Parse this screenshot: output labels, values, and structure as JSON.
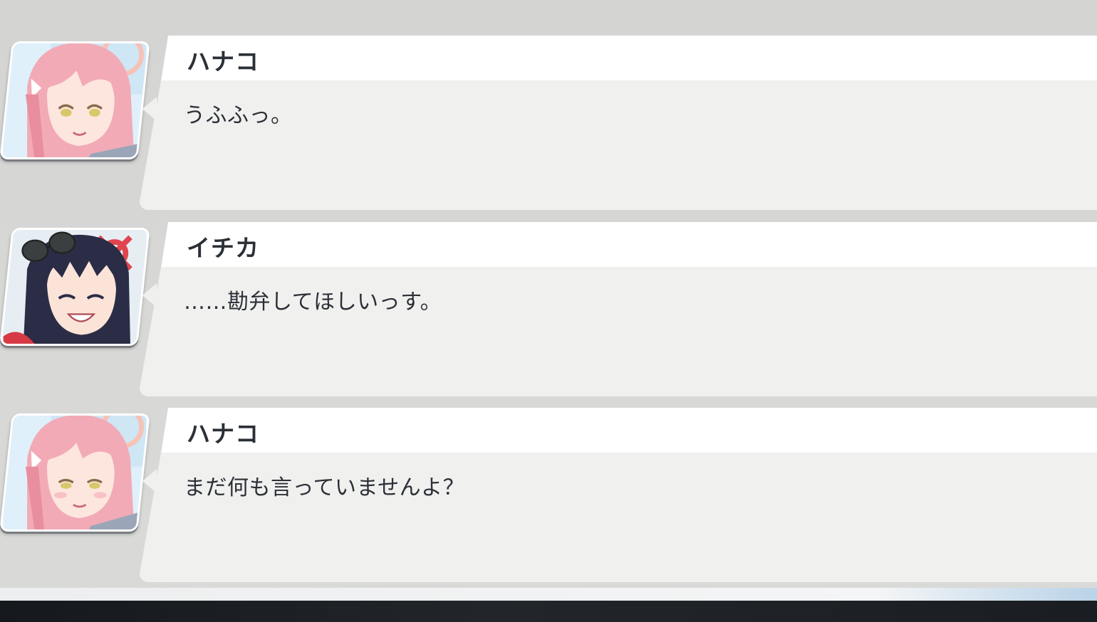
{
  "dialogue_log": [
    {
      "speaker": "ハナコ",
      "text": "うふふっ。",
      "portrait": {
        "icon": "hanako-portrait",
        "hair_color": "#f2aab7",
        "eye_color": "#d7c86a",
        "bg_color": "#dff0fa"
      }
    },
    {
      "speaker": "イチカ",
      "text": "……勘弁してほしいっす。",
      "portrait": {
        "icon": "ichika-portrait",
        "hair_color": "#2a2d45",
        "eye_color": "#2a2d45",
        "bg_color": "#e6eef4"
      }
    },
    {
      "speaker": "ハナコ",
      "text": "まだ何も言っていませんよ？",
      "portrait": {
        "icon": "hanako-portrait",
        "hair_color": "#f2aab7",
        "eye_color": "#d7c86a",
        "bg_color": "#dff0fa"
      }
    }
  ],
  "colors": {
    "name_text": "#2b2f36",
    "bubble_bg": "#f0f0ef",
    "panel_bg": "#d6d6d4"
  }
}
